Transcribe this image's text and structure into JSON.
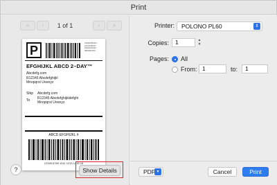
{
  "dialog": {
    "title": "Print"
  },
  "preview": {
    "page_indicator": "1 of 1",
    "nav_first": "«",
    "nav_prev": "‹",
    "nav_next": "›",
    "nav_last": "»",
    "label": {
      "carrier_letter": "P",
      "service": "EFGHIJKL ABCD 2–DAY™",
      "from_lines": [
        "Abcdefg.com",
        "R12345 Abcdefghijkl",
        "Mnopqrst Uvwxyz"
      ],
      "ship_label": "Ship",
      "to_label": "To",
      "to_lines": [
        "Abcdefg.com",
        "R12345 Abcdefghijkldefghi",
        "Mnopqrst Uvwxyz"
      ],
      "barcode_title": "ABCD EFGHIJKL #",
      "barcode_number": "12345 6789 1011 1213 1415 16",
      "mini_text": [
        "1234567891011",
        "121314151617",
        "181920212223",
        "ABCDEFGHIJ"
      ]
    }
  },
  "help_button": "?",
  "show_details_button": "Show Details",
  "settings": {
    "printer_label": "Printer:",
    "printer_value": "POLONO PL60",
    "copies_label": "Copies:",
    "copies_value": "1",
    "pages_label": "Pages:",
    "pages_all_label": "All",
    "pages_from_label": "From:",
    "pages_from_value": "1",
    "pages_to_label": "to:",
    "pages_to_value": "1"
  },
  "footer": {
    "pdf_label": "PDF",
    "cancel_label": "Cancel",
    "print_label": "Print"
  },
  "colors": {
    "accent": "#2d7cf0",
    "highlight_box": "#d22a2a"
  }
}
